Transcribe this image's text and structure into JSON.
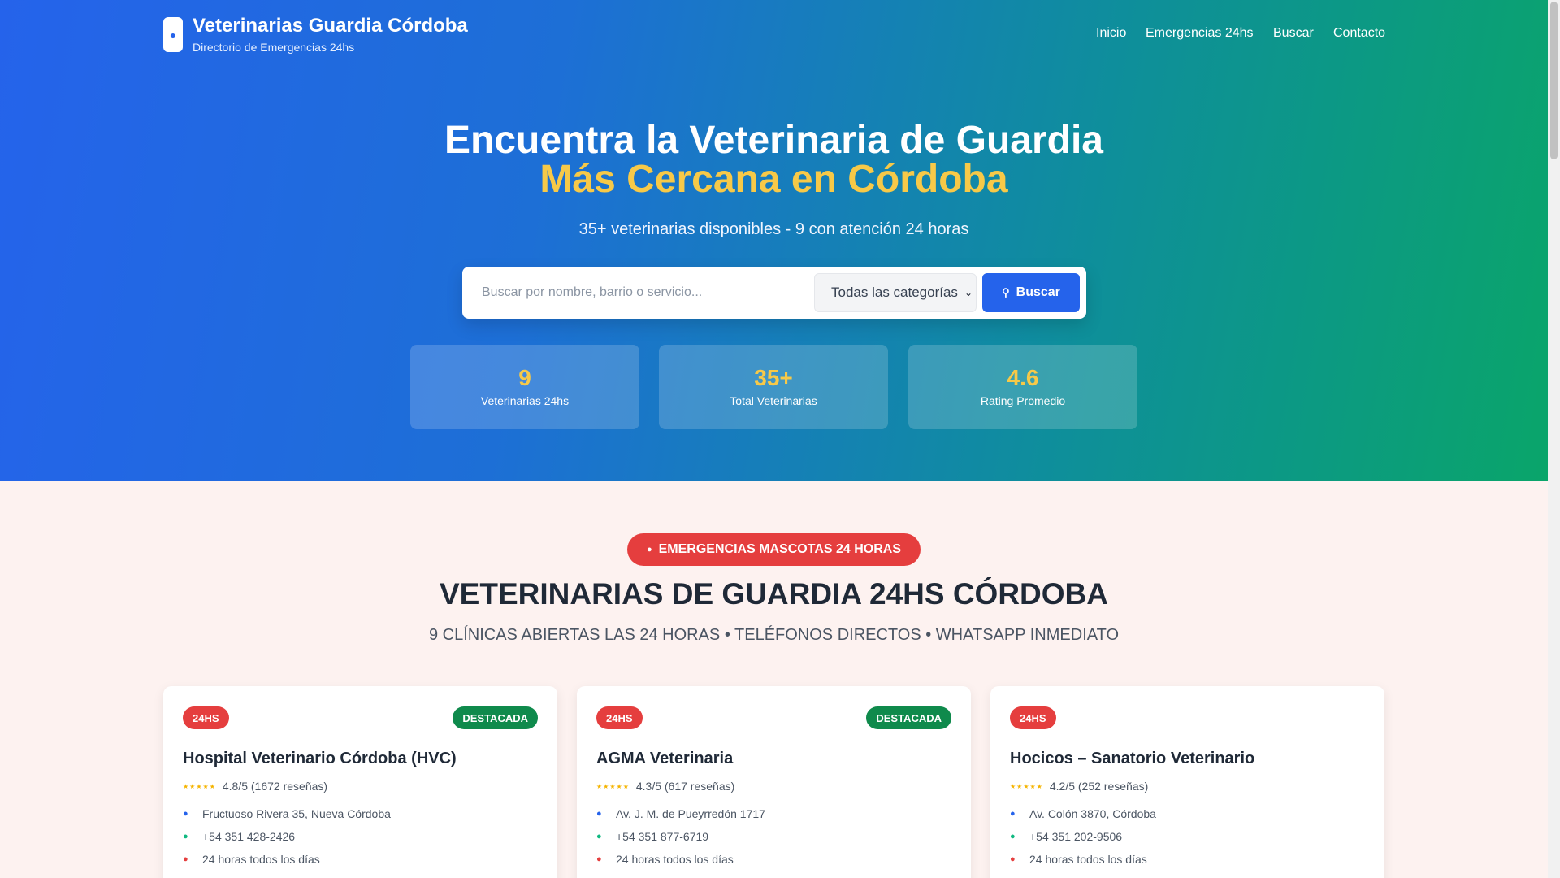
{
  "brand": {
    "icon": "paw-icon",
    "title": "Veterinarias Guardia Córdoba",
    "subtitle": "Directorio de Emergencias 24hs"
  },
  "nav": {
    "items": [
      "Inicio",
      "Emergencias 24hs",
      "Buscar",
      "Contacto"
    ]
  },
  "hero": {
    "title_line1": "Encuentra la Veterinaria de Guardia",
    "title_line2": "Más Cercana en Córdoba",
    "subtitle": "35+ veterinarias disponibles - 9 con atención 24 horas",
    "accent_color": "#f7c948"
  },
  "search": {
    "placeholder": "Buscar por nombre, barrio o servicio...",
    "value": "",
    "category_selected": "Todas las categorías",
    "button_label": "Buscar"
  },
  "stats": [
    {
      "value": "9",
      "label": "Veterinarias 24hs"
    },
    {
      "value": "35+",
      "label": "Total Veterinarias"
    },
    {
      "value": "4.6",
      "label": "Rating Promedio"
    }
  ],
  "emergency": {
    "pill_label": "EMERGENCIAS MASCOTAS 24 HORAS",
    "title": "VETERINARIAS DE GUARDIA 24HS CÓRDOBA",
    "subtitle": "9 CLÍNICAS ABIERTAS LAS 24 HORAS • TELÉFONOS DIRECTOS • WHATSAPP INMEDIATO"
  },
  "cards": [
    {
      "badge": "24HS",
      "featured": "DESTACADA",
      "name": "Hospital Veterinario Córdoba (HVC)",
      "rating": "4.8/5 (1672 reseñas)",
      "address": "Fructuoso Rivera 35, Nueva Córdoba",
      "phone": "+54 351 428-2426",
      "hours": "24 horas todos los días"
    },
    {
      "badge": "24HS",
      "featured": "DESTACADA",
      "name": "AGMA Veterinaria",
      "rating": "4.3/5 (617 reseñas)",
      "address": "Av. J. M. de Pueyrredón 1717",
      "phone": "+54 351 877-6719",
      "hours": "24 horas todos los días"
    },
    {
      "badge": "24HS",
      "featured": "",
      "name": "Hocicos – Sanatorio Veterinario",
      "rating": "4.2/5 (252 reseñas)",
      "address": "Av. Colón 3870, Córdoba",
      "phone": "+54 351 202-9506",
      "hours": "24 horas todos los días"
    }
  ],
  "colors": {
    "primary": "#2563eb",
    "danger": "#e53e3e",
    "success": "#0f8a4c",
    "star": "#f5b400"
  }
}
